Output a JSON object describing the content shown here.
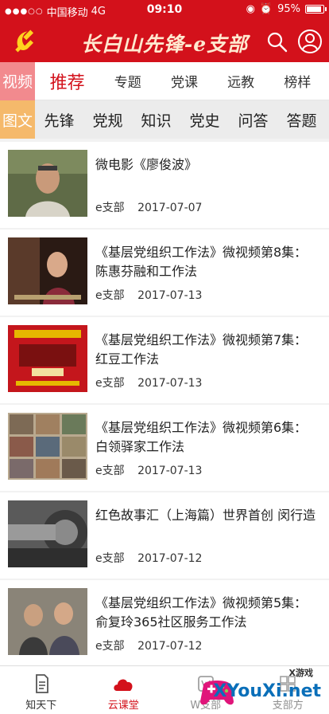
{
  "status_bar": {
    "carrier": "中国移动",
    "network": "4G",
    "time": "09:10",
    "battery_text": "95%",
    "battery_level": 0.95
  },
  "header": {
    "title": "长白山先锋-e支部",
    "logo_icon": "hammer-sickle-icon",
    "search_icon": "search-icon",
    "user_icon": "user-icon"
  },
  "video_row": {
    "label": "视频",
    "items": [
      "推荐",
      "专题",
      "党课",
      "远教",
      "榜样"
    ],
    "active_index": 0
  },
  "text_row": {
    "label": "图文",
    "items": [
      "先锋",
      "党规",
      "知识",
      "党史",
      "问答",
      "答题"
    ]
  },
  "articles": [
    {
      "title": "微电影《廖俊波》",
      "source": "e支部",
      "date": "2017-07-07"
    },
    {
      "title": "《基层党组织工作法》微视频第8集：陈惠芬融和工作法",
      "source": "e支部",
      "date": "2017-07-13"
    },
    {
      "title": "《基层党组织工作法》微视频第7集：红豆工作法",
      "source": "e支部",
      "date": "2017-07-13"
    },
    {
      "title": "《基层党组织工作法》微视频第6集：白领驿家工作法",
      "source": "e支部",
      "date": "2017-07-13"
    },
    {
      "title": "红色故事汇（上海篇）世界首创 闵行造",
      "source": "e支部",
      "date": "2017-07-12"
    },
    {
      "title": "《基层党组织工作法》微视频第5集：俞复玲365社区服务工作法",
      "source": "e支部",
      "date": "2017-07-12"
    }
  ],
  "tab_bar": {
    "tabs": [
      {
        "label": "知天下",
        "icon": "document-icon"
      },
      {
        "label": "云课堂",
        "icon": "cloud-icon"
      },
      {
        "label": "W支部",
        "icon": "branch-icon"
      },
      {
        "label": "支部方",
        "icon": "grid-icon"
      }
    ],
    "active_index": 1
  },
  "watermark": {
    "text": "XYouXi.net",
    "small": "X游戏"
  },
  "colors": {
    "brand_red": "#d3111b",
    "video_label_bg": "#f28a8e",
    "text_label_bg": "#f5b96b"
  }
}
